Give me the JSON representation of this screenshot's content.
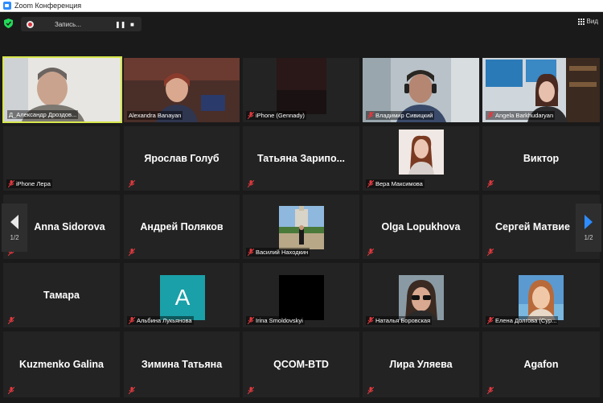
{
  "window": {
    "title": "Zoom Конференция"
  },
  "topbar": {
    "record_label": "Запись...",
    "pause_icon": "pause-icon",
    "stop_icon": "stop-icon",
    "view_label": "Вид"
  },
  "nav": {
    "prev_page": "1/2",
    "next_page": "1/2"
  },
  "colors": {
    "active_speaker": "#d7e64d",
    "muted_mic": "#e0393e",
    "tile_bg": "#232323",
    "accent_blue": "#2d8cff"
  },
  "participants": [
    {
      "name": "Д_Александр Дроздов...",
      "video": true,
      "active": true
    },
    {
      "name": "Alexandra Banayan",
      "video": true
    },
    {
      "name": "iPhone (Gennady)",
      "video": true
    },
    {
      "name": "Владимир Сивицкий",
      "video": true
    },
    {
      "name": "Angela Barkhudaryan",
      "video": true
    },
    {
      "name": "iPhone  Лера",
      "video": false,
      "big": ""
    },
    {
      "name": "",
      "big": "Ярослав Голуб"
    },
    {
      "name": "",
      "big": "Татьяна  Зарипо..."
    },
    {
      "name": "Вера Максимова",
      "video": true
    },
    {
      "name": "",
      "big": "Виктор"
    },
    {
      "name": "",
      "big": "Anna Sidorova"
    },
    {
      "name": "",
      "big": "Андрей Поляков"
    },
    {
      "name": "Василий Находкин",
      "video": true
    },
    {
      "name": "",
      "big": "Olga Lopukhova"
    },
    {
      "name": "",
      "big": "Сергей  Матвие"
    },
    {
      "name": "",
      "big": "Тамара"
    },
    {
      "name": "Альбина Лукьянова",
      "avatar_letter": "A"
    },
    {
      "name": "Irina Smoldovskyi",
      "video": true
    },
    {
      "name": "Наталья Боровская",
      "video": true
    },
    {
      "name": "Елена Долгова (Сур...",
      "video": true
    },
    {
      "name": "",
      "big": "Kuzmenko Galina"
    },
    {
      "name": "",
      "big": "Зимина Татьяна"
    },
    {
      "name": "",
      "big": "QCOM-BTD"
    },
    {
      "name": "",
      "big": "Лира Уляева"
    },
    {
      "name": "",
      "big": "Agafon"
    }
  ]
}
